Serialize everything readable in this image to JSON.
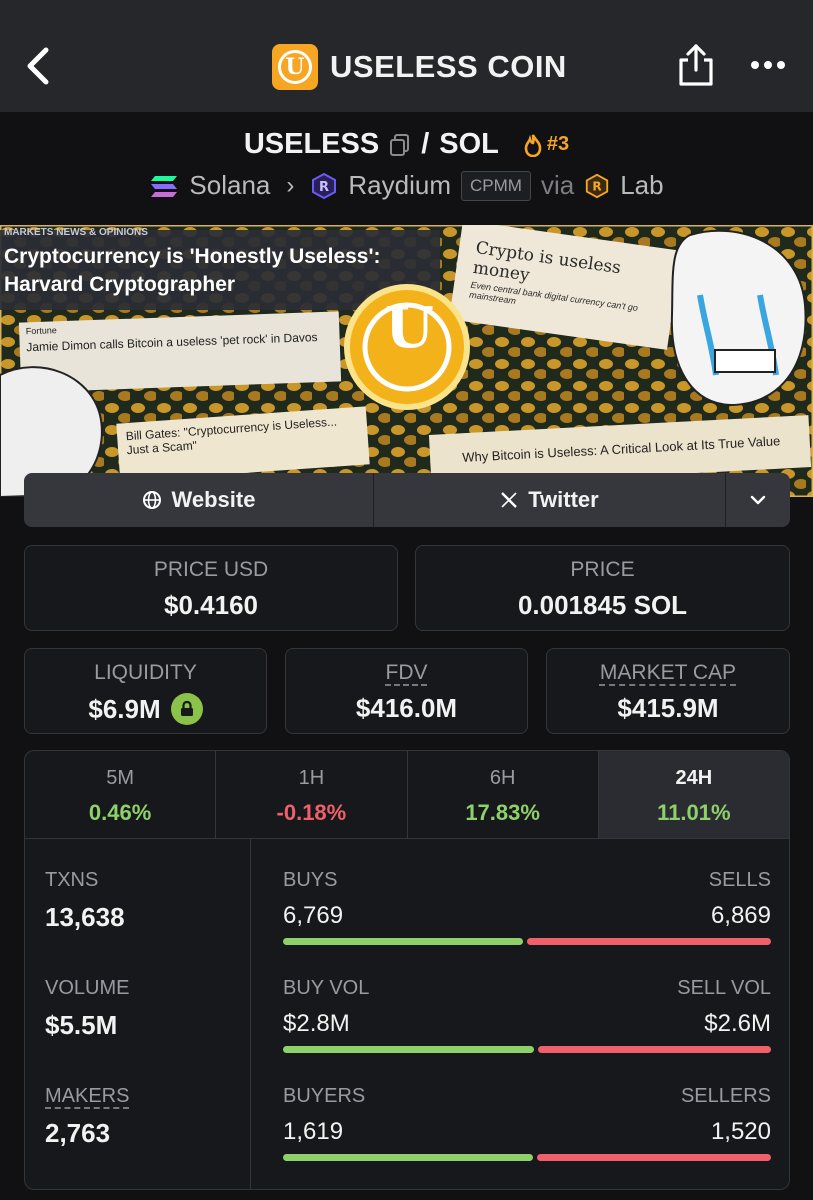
{
  "header": {
    "title": "USELESS COIN",
    "logo_letter": "U"
  },
  "pair": {
    "base": "USELESS",
    "separator": "/",
    "quote": "SOL",
    "rank": "#3",
    "chain": "Solana",
    "dex": "Raydium",
    "pool_type": "CPMM",
    "via_label": "via",
    "launchpad": "Lab"
  },
  "banner": {
    "headline1": "Cryptocurrency is 'Honestly Useless':",
    "headline2": "Harvard Cryptographer",
    "tag_top": "MARKETS NEWS & OPINIONS",
    "clip1_title": "Crypto is useless money",
    "clip1_sub": "Even central bank digital currency can't go mainstream",
    "clip2_line1": "Fortune",
    "clip2_line2": "Jamie Dimon calls Bitcoin a useless 'pet rock' in Davos",
    "clip3": "Bill Gates: \"Cryptocurrency is Useless... Just a Scam\"",
    "clip4": "Why Bitcoin is Useless: A Critical Look at Its True Value",
    "coin_letter": "U"
  },
  "links": {
    "website": "Website",
    "twitter": "Twitter"
  },
  "prices": {
    "price_usd_label": "PRICE USD",
    "price_usd": "$0.4160",
    "price_label": "PRICE",
    "price_sol": "0.001845 SOL"
  },
  "metrics": {
    "liquidity_label": "LIQUIDITY",
    "liquidity": "$6.9M",
    "fdv_label": "FDV",
    "fdv": "$416.0M",
    "mcap_label": "MARKET CAP",
    "mcap": "$415.9M"
  },
  "timeframes": [
    {
      "label": "5M",
      "change": "0.46%"
    },
    {
      "label": "1H",
      "change": "-0.18%"
    },
    {
      "label": "6H",
      "change": "17.83%"
    },
    {
      "label": "24H",
      "change": "11.01%"
    }
  ],
  "stats": {
    "txns_label": "TXNS",
    "txns": "13,638",
    "volume_label": "VOLUME",
    "volume": "$5.5M",
    "makers_label": "MAKERS",
    "makers": "2,763",
    "buys_label": "BUYS",
    "buys": "6,769",
    "sells_label": "SELLS",
    "sells": "6,869",
    "buy_vol_label": "BUY VOL",
    "buy_vol": "$2.8M",
    "sell_vol_label": "SELL VOL",
    "sell_vol": "$2.6M",
    "buyers_label": "BUYERS",
    "buyers": "1,619",
    "sellers_label": "SELLERS",
    "sellers": "1,520",
    "buys_ratio": 0.496,
    "buy_vol_ratio": 0.518,
    "buyers_ratio": 0.516
  },
  "colors": {
    "accent": "#f6a623",
    "positive": "#8ed16a",
    "negative": "#f0606a"
  }
}
